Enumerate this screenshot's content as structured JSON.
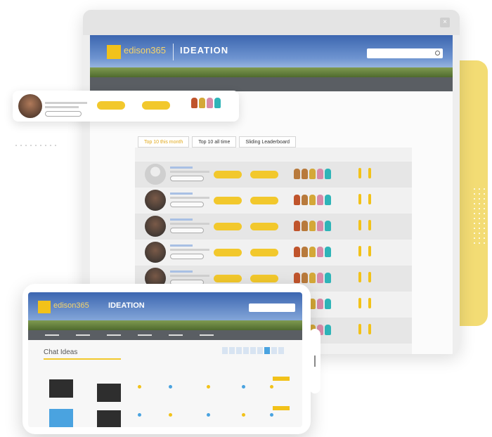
{
  "app": {
    "brand": "edison365",
    "product": "IDEATION",
    "close_glyph": "×"
  },
  "table": {
    "tabs": [
      {
        "label": "Top 10 this month",
        "active": true
      },
      {
        "label": "Top 10 all time",
        "active": false
      },
      {
        "label": "Sliding Leaderboard",
        "active": false
      }
    ]
  },
  "phone": {
    "title": "Chat Ideas"
  },
  "colors": {
    "accent_yellow": "#f2c82c",
    "nav_gray": "#5a5e63",
    "link_blue": "#4a79c2",
    "card_yellow": "#f3dc74"
  }
}
